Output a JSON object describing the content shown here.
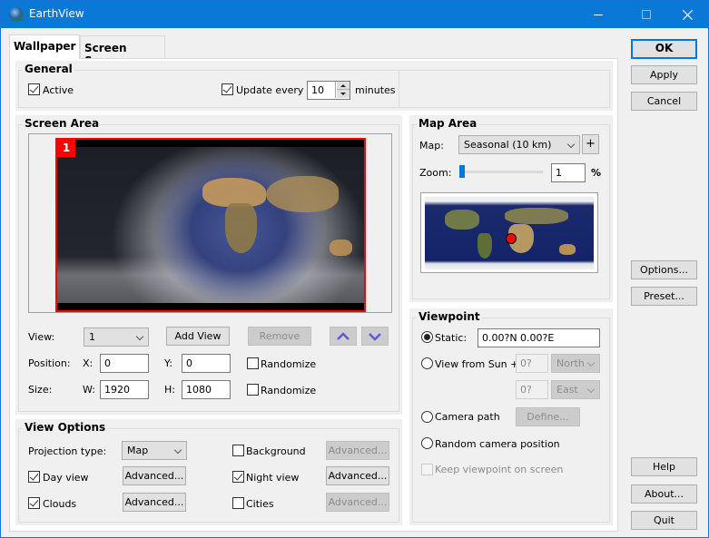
{
  "window": {
    "title": "EarthView",
    "accent_color": "#0078d7"
  },
  "tabs": [
    {
      "label": "Wallpaper",
      "active": true
    },
    {
      "label": "Screen Saver",
      "active": false
    }
  ],
  "general": {
    "title": "General",
    "active_label": "Active",
    "active_checked": true,
    "update_label": "Update every",
    "update_checked": true,
    "update_value": "10",
    "update_unit": "minutes"
  },
  "screen_area": {
    "title": "Screen Area",
    "screen_badge": "1",
    "view_label": "View:",
    "view_value": "1",
    "add_view_label": "Add View",
    "remove_label": "Remove",
    "position_label": "Position:",
    "x_label": "X:",
    "x_value": "0",
    "y_label": "Y:",
    "y_value": "0",
    "randomize_position_label": "Randomize",
    "size_label": "Size:",
    "w_label": "W:",
    "w_value": "1920",
    "h_label": "H:",
    "h_value": "1080",
    "randomize_size_label": "Randomize"
  },
  "view_options": {
    "title": "View Options",
    "projection_label": "Projection type:",
    "projection_value": "Map",
    "day_view_label": "Day view",
    "day_view_checked": true,
    "clouds_label": "Clouds",
    "clouds_checked": true,
    "background_label": "Background",
    "background_checked": false,
    "night_view_label": "Night view",
    "night_view_checked": true,
    "cities_label": "Cities",
    "cities_checked": false,
    "advanced_label": "Advanced..."
  },
  "map_area": {
    "title": "Map Area",
    "map_label": "Map:",
    "map_value": "Seasonal (10 km)",
    "plus_label": "+",
    "zoom_label": "Zoom:",
    "zoom_value": "1",
    "zoom_unit": "%",
    "zoom_slider_fraction": 0.01
  },
  "viewpoint": {
    "title": "Viewpoint",
    "static_label": "Static:",
    "static_value": "0.00?N   0.00?E",
    "sun_label": "View from Sun +",
    "sun_lat_value": "0?",
    "sun_lat_dir": "North",
    "sun_lon_value": "0?",
    "sun_lon_dir": "East",
    "camera_path_label": "Camera path",
    "define_label": "Define...",
    "random_label": "Random camera position",
    "keep_label": "Keep viewpoint on screen",
    "selected": "Static"
  },
  "side_buttons": {
    "ok": "OK",
    "apply": "Apply",
    "cancel": "Cancel",
    "options": "Options...",
    "preset": "Preset...",
    "help": "Help",
    "about": "About...",
    "quit": "Quit"
  }
}
